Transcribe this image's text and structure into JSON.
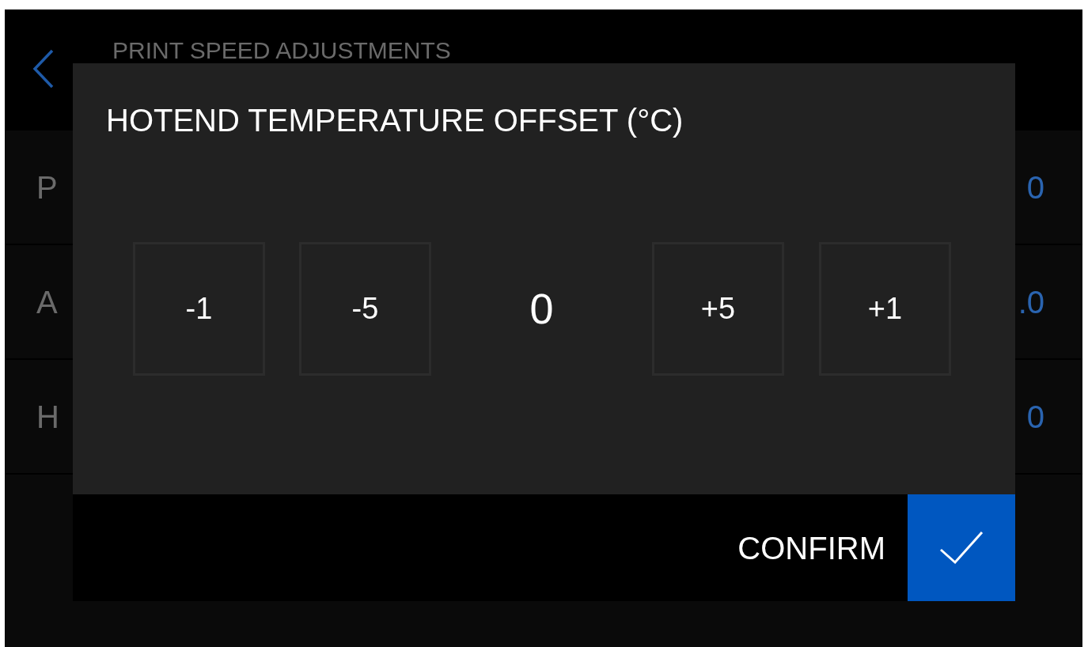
{
  "header": {
    "title": "PRINT SPEED ADJUSTMENTS"
  },
  "rows": [
    {
      "label": "P",
      "value": "0"
    },
    {
      "label": "A",
      "value": ".0"
    },
    {
      "label": "H",
      "value": "0"
    }
  ],
  "dialog": {
    "title": "HOTEND TEMPERATURE OFFSET (°C)",
    "decrease_steps": [
      "-1",
      "-5"
    ],
    "value": "0",
    "increase_steps": [
      "+5",
      "+1"
    ],
    "confirm": "CONFIRM"
  }
}
